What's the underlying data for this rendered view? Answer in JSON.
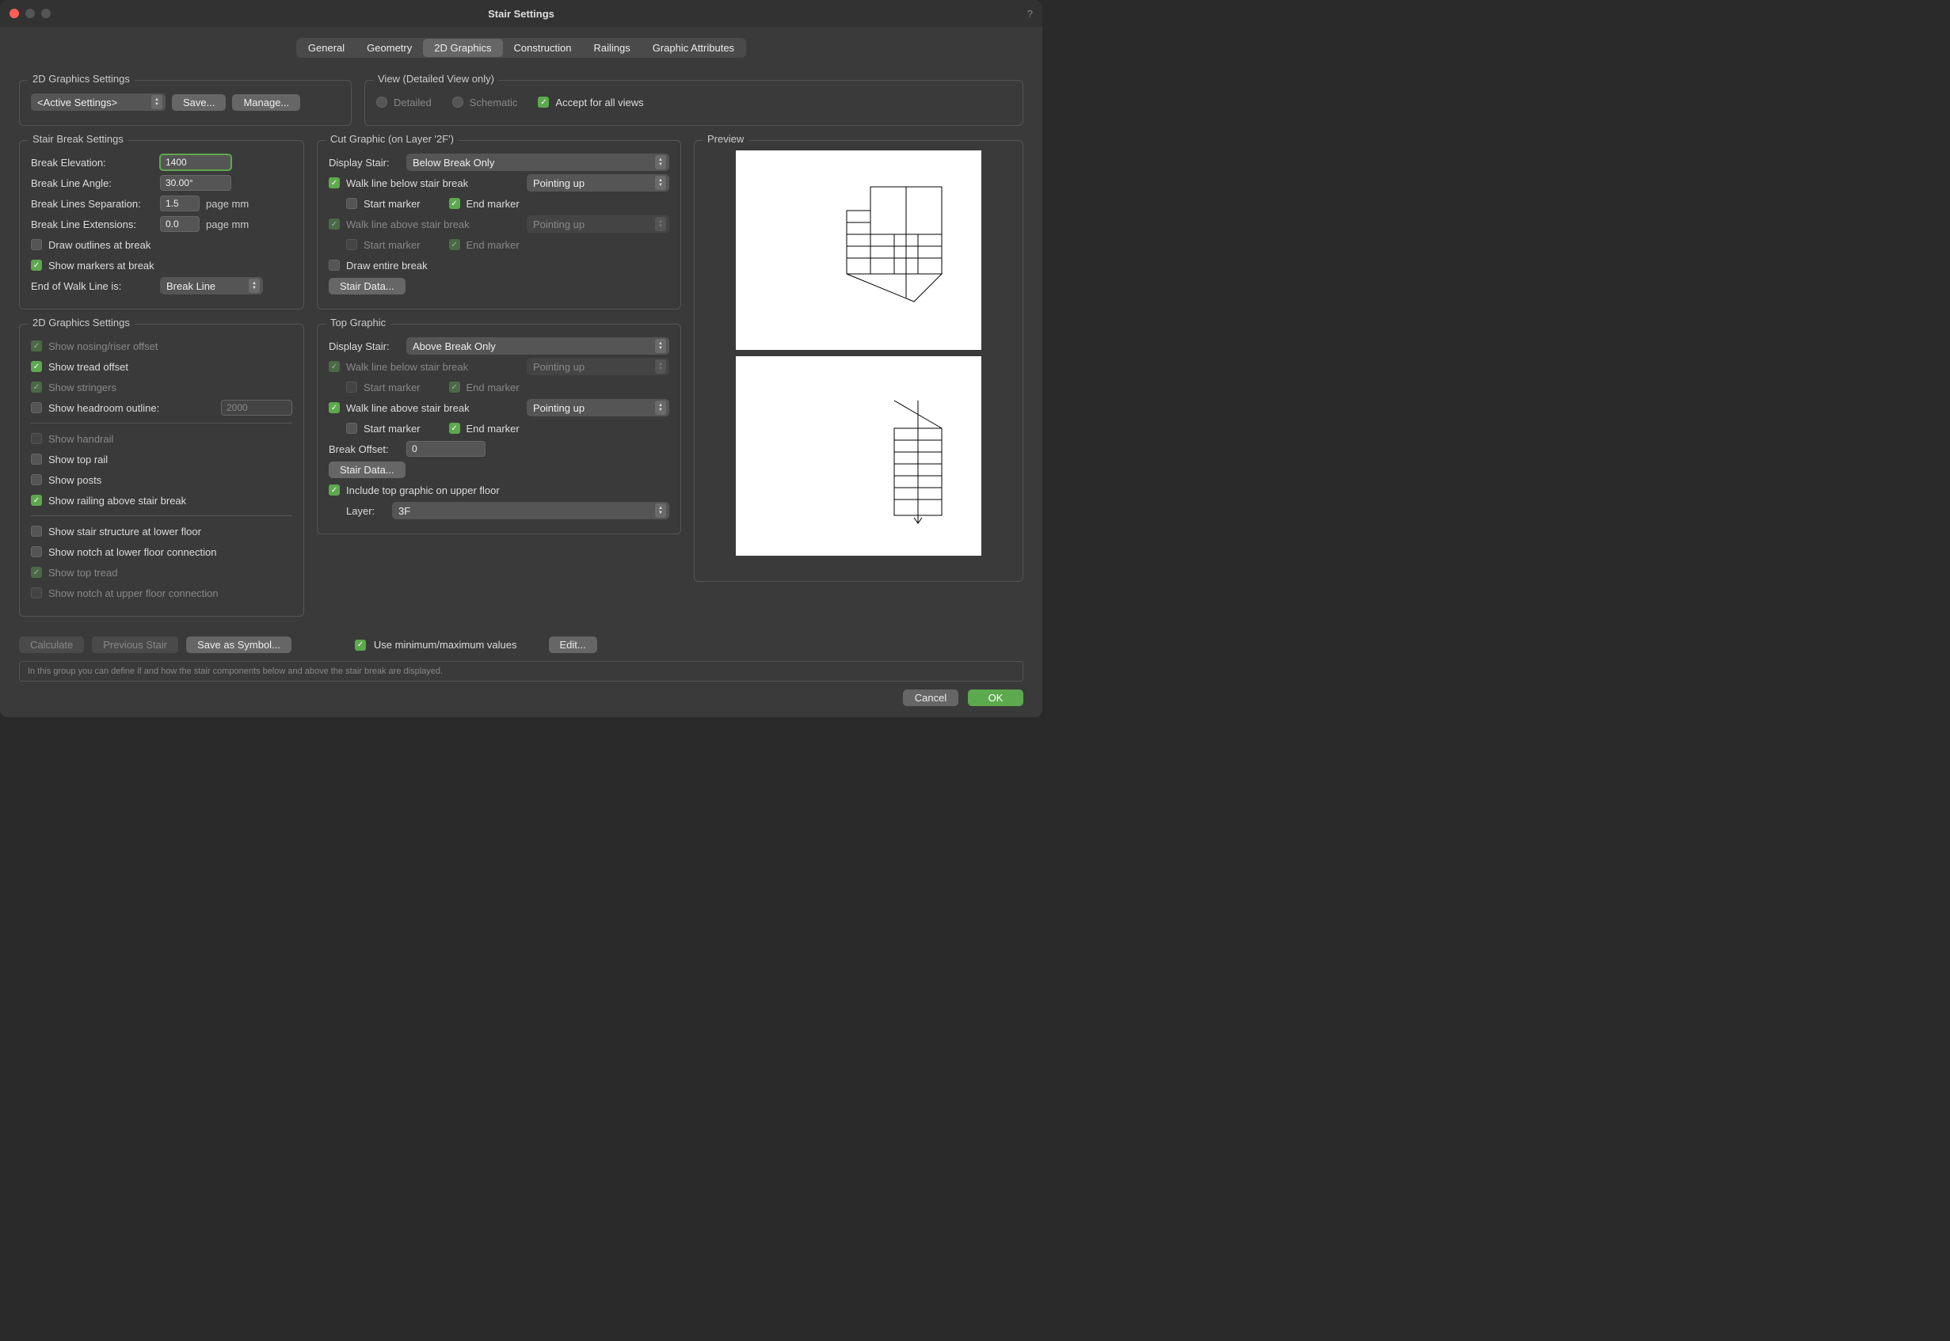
{
  "window": {
    "title": "Stair Settings"
  },
  "tabs": [
    "General",
    "Geometry",
    "2D Graphics",
    "Construction",
    "Railings",
    "Graphic Attributes"
  ],
  "active_tab": "2D Graphics",
  "top_left": {
    "title": "2D Graphics Settings",
    "preset": "<Active Settings>",
    "save": "Save...",
    "manage": "Manage..."
  },
  "view": {
    "title": "View (Detailed View only)",
    "detailed": "Detailed",
    "schematic": "Schematic",
    "accept": "Accept for all views"
  },
  "break": {
    "title": "Stair Break Settings",
    "elev_label": "Break Elevation:",
    "elev": "1400",
    "angle_label": "Break Line Angle:",
    "angle": "30.00°",
    "sep_label": "Break Lines Separation:",
    "sep": "1.5",
    "ext_label": "Break Line Extensions:",
    "ext": "0.0",
    "page_mm": "page mm",
    "draw_outlines": "Draw outlines at break",
    "show_markers": "Show markers at break",
    "end_label": "End of Walk Line is:",
    "end_value": "Break Line"
  },
  "gs2d": {
    "title": "2D Graphics Settings",
    "nosing": "Show nosing/riser offset",
    "tread": "Show tread offset",
    "stringers": "Show stringers",
    "headroom": "Show headroom outline:",
    "headroom_val": "2000",
    "handrail": "Show handrail",
    "toprail": "Show top rail",
    "posts": "Show posts",
    "railing_above": "Show railing above stair break",
    "structure_lower": "Show stair structure at lower floor",
    "notch_lower": "Show notch at lower floor connection",
    "top_tread": "Show top tread",
    "notch_upper": "Show notch at upper floor connection"
  },
  "cut": {
    "title": "Cut Graphic (on Layer '2F')",
    "display_label": "Display Stair:",
    "display_value": "Below Break Only",
    "walk_below": "Walk line below stair break",
    "walk_above": "Walk line above stair break",
    "start_marker": "Start marker",
    "end_marker": "End marker",
    "pointing_up": "Pointing up",
    "draw_entire": "Draw entire break",
    "stair_data": "Stair Data..."
  },
  "top": {
    "title": "Top Graphic",
    "display_label": "Display Stair:",
    "display_value": "Above Break Only",
    "walk_below": "Walk line below stair break",
    "walk_above": "Walk line above stair break",
    "start_marker": "Start marker",
    "end_marker": "End marker",
    "pointing_up": "Pointing up",
    "offset_label": "Break Offset:",
    "offset": "0",
    "stair_data": "Stair Data...",
    "include": "Include top graphic on upper floor",
    "layer_label": "Layer:",
    "layer": "3F"
  },
  "preview": {
    "title": "Preview"
  },
  "footer": {
    "calculate": "Calculate",
    "previous": "Previous Stair",
    "save_symbol": "Save as Symbol...",
    "use_minmax": "Use minimum/maximum values",
    "edit": "Edit...",
    "hint": "In this group you can define if and how the stair components below and above the stair break are displayed.",
    "cancel": "Cancel",
    "ok": "OK"
  }
}
